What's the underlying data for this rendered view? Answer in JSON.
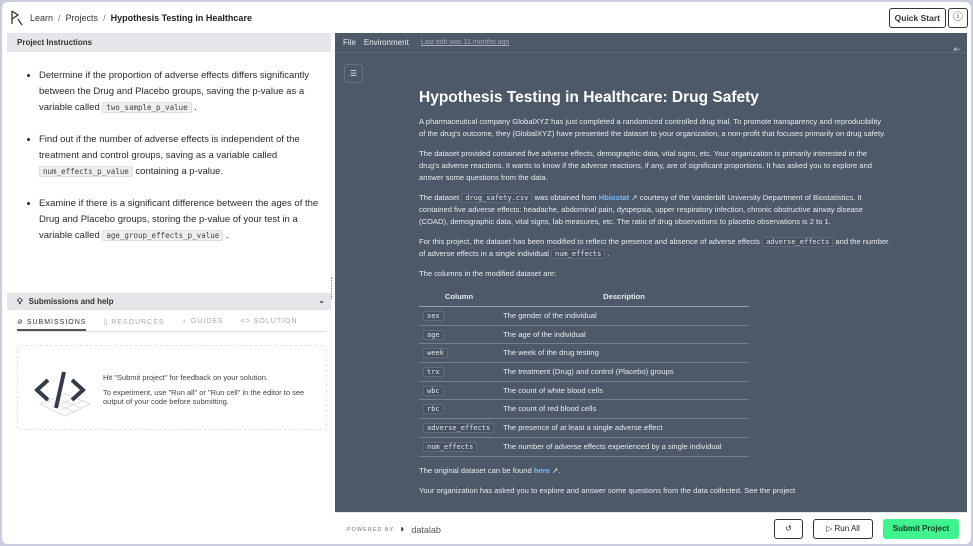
{
  "header": {
    "breadcrumb": [
      "Learn",
      "Projects",
      "Hypothesis Testing in Healthcare"
    ],
    "quick_start": "Quick Start"
  },
  "instructions": {
    "title": "Project Instructions",
    "items": [
      {
        "pre": "Determine if the proportion of adverse effects differs significantly between the Drug and Placebo groups, saving the p-value as a variable called ",
        "code": "two_sample_p_value",
        "post": " ."
      },
      {
        "pre": "Find out if the number of adverse effects is independent of the treatment and control groups, saving as a variable called ",
        "code": "num_effects_p_value",
        "post": " containing a p-value."
      },
      {
        "pre": "Examine if there is a significant difference between the ages of the Drug and Placebo groups, storing the p-value of your test in a variable called ",
        "code": "age_group_effects_p_value",
        "post": " ."
      }
    ]
  },
  "help": {
    "title": "Submissions and help",
    "tabs": [
      "SUBMISSIONS",
      "RESOURCES",
      "GUIDES",
      "SOLUTION"
    ],
    "msg1": "Hit \"Submit project\" for feedback on your solution.",
    "msg2": "To experiment, use \"Run all\" or \"Run cell\" in the editor to see output of your code before submitting."
  },
  "editor": {
    "menu": [
      "File",
      "Environment"
    ],
    "last_edit": "Last edit was 11 months ago",
    "title": "Hypothesis Testing in Healthcare: Drug Safety",
    "p1": "A pharmaceutical company GlobalXYZ has just completed a randomized controlled drug trial. To promote transparency and reproducibility of the drug's outcome, they (GlobalXYZ) have presented the dataset to your organization, a non-profit that focuses primarily on drug safety.",
    "p2": "The dataset provided contained five adverse effects, demographic data, vital signs, etc. Your organization is primarily interested in the drug's adverse reactions. It wants to know if the adverse reactions, if any, are of significant proportions. It has asked you to explore and answer some questions from the data.",
    "p3a": "The dataset ",
    "p3code": "drug_safety.csv",
    "p3b": " was obtained from ",
    "p3link": "Hbiostat",
    "p3c": " courtesy of the Vanderbilt University Department of Biostatistics. It contained five adverse effects: headache, abdominal pain, dyspepsia, upper respiratory infection, chronic obstructive airway disease (COAD), demographic data, vital signs, lab measures, etc. The ratio of drug observations to placebo observations is 2 to 1.",
    "p4a": "For this project, the dataset has been modified to reflect the presence and absence of adverse effects ",
    "p4code1": "adverse_effects",
    "p4b": " and the number of adverse effects in a single individual ",
    "p4code2": "num_effects",
    "p4c": " .",
    "p5": "The columns in the modified dataset are:",
    "table": {
      "headers": [
        "Column",
        "Description"
      ],
      "rows": [
        [
          "sex",
          "The gender of the individual"
        ],
        [
          "age",
          "The age of the individual"
        ],
        [
          "week",
          "The week of the drug testing"
        ],
        [
          "trx",
          "The treatment (Drug) and control (Placebo) groups"
        ],
        [
          "wbc",
          "The count of white blood cells"
        ],
        [
          "rbc",
          "The count of red blood cells"
        ],
        [
          "adverse_effects",
          "The presence of at least a single adverse effect"
        ],
        [
          "num_effects",
          "The number of adverse effects experienced by a single individual"
        ]
      ]
    },
    "p6a": "The original dataset can be found ",
    "p6link": "here",
    "p6b": ".",
    "p7": "Your organization has asked you to explore and answer some questions from the data collected. See the project"
  },
  "footer": {
    "powered_by": "POWERED BY",
    "brand": "datalab",
    "run_all": "Run All",
    "submit": "Submit Project"
  }
}
